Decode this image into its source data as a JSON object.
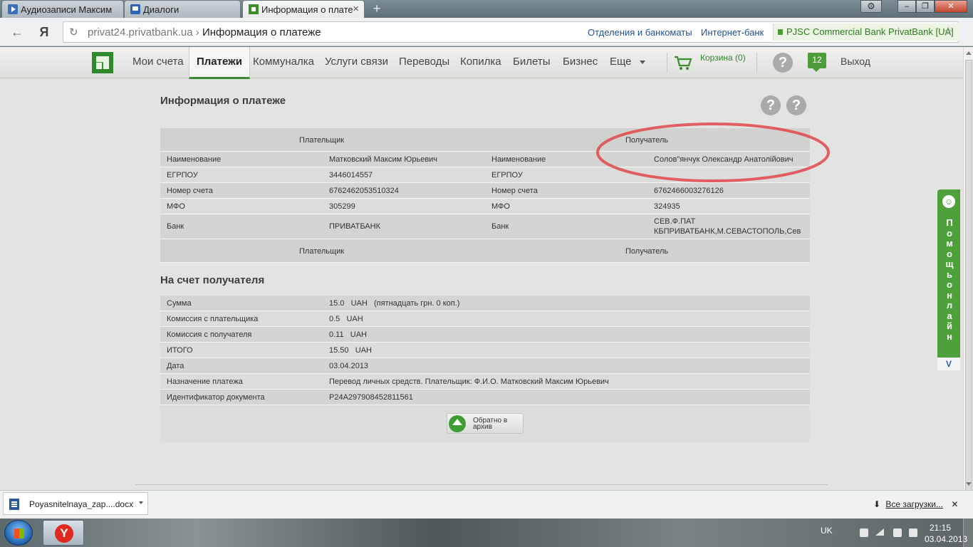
{
  "browser": {
    "tabs": [
      {
        "label": "Аудиозаписи Максим",
        "icon": "audio-icon"
      },
      {
        "label": "Диалоги",
        "icon": "dialogs-icon"
      },
      {
        "label": "Информация о плате",
        "icon": "privatbank-icon"
      }
    ],
    "address": {
      "domain": "privat24.privatbank.ua",
      "separator": "›",
      "page_title": "Информация о платеже"
    },
    "links": [
      "Отделения и банкоматы",
      "Интернет-банк"
    ],
    "ev_certificate": "PJSC Commercial Bank PrivatBank [UA]",
    "yandex_label": "Я"
  },
  "menu": {
    "items": [
      "Мои счета",
      "Платежи",
      "Коммуналка",
      "Услуги связи",
      "Переводы",
      "Копилка",
      "Билеты",
      "Бизнес",
      "Еще"
    ],
    "active": "Платежи",
    "cart": "Корзина (0)",
    "help": "?",
    "messages_count": "12",
    "logout": "Выход"
  },
  "page": {
    "title": "Информация о платеже",
    "payer_header": "Плательщик",
    "recipient_header": "Получатель",
    "details_rows": [
      {
        "label": "Наименование",
        "payer": "Матковский Максим Юрьевич",
        "label2": "Наименование",
        "recipient": "Солов\"янчук Олександр Анатолійович"
      },
      {
        "label": "ЕГРПОУ",
        "payer": "3446014557",
        "label2": "ЕГРПОУ",
        "recipient": ""
      },
      {
        "label": "Номер счета",
        "payer": "6762462053510324",
        "label2": "Номер счета",
        "recipient": "6762466003276126"
      },
      {
        "label": "МФО",
        "payer": "305299",
        "label2": "МФО",
        "recipient": "324935"
      },
      {
        "label": "Банк",
        "payer": "ПРИВАТБАНК",
        "label2": "Банк",
        "recipient_line1": "СЕВ.Ф.ПАТ",
        "recipient_line2": "КБПРИВАТБАНК,М.СЕВАСТОПОЛЬ,Сев"
      }
    ],
    "section2_title": "На счет получателя",
    "summary_rows": [
      {
        "label": "Сумма",
        "value": "15.0   UAH   (пятнадцать грн. 0 коп.)"
      },
      {
        "label": "Комиссия с плательщика",
        "value": "0.5   UAH"
      },
      {
        "label": "Комиссия с получателя",
        "value": "0.11   UAH"
      },
      {
        "label": "ИТОГО",
        "value": "15.50   UAH"
      },
      {
        "label": "Дата",
        "value": "03.04.2013"
      },
      {
        "label": "Назначение платежа",
        "value": "Перевод личных средств. Плательщик: Ф.И.О. Матковский Максим Юрьевич"
      },
      {
        "label": "Идентификатор документа",
        "value": "P24A297908452811561"
      }
    ],
    "back_button": "Обратно в архив",
    "help_online": "Помощь онлайн",
    "help_online_bottom": "V"
  },
  "downloads": {
    "file": "Poyasnitelnaya_zap....docx",
    "all": "Все загрузки..."
  },
  "taskbar": {
    "language": "UK",
    "time": "21:15",
    "date": "03.04.2013"
  },
  "colors": {
    "brand_green": "#3b8c2f",
    "highlight_circle": "#e0484a"
  }
}
